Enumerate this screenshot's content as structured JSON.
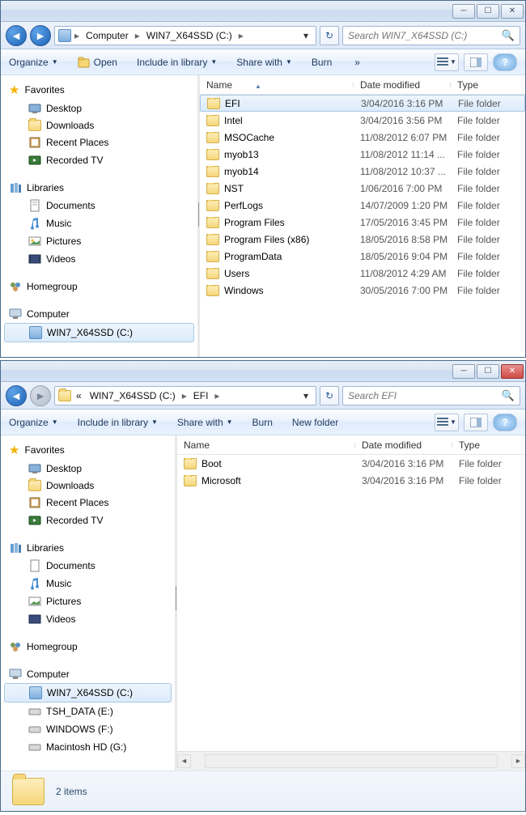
{
  "window1": {
    "breadcrumbs": [
      "Computer",
      "WIN7_X64SSD (C:)"
    ],
    "searchPlaceholder": "Search WIN7_X64SSD (C:)",
    "toolbar": {
      "organize": "Organize",
      "open": "Open",
      "include": "Include in library",
      "share": "Share with",
      "burn": "Burn",
      "more": "»"
    },
    "sidebar": {
      "favorites": {
        "label": "Favorites",
        "items": [
          "Desktop",
          "Downloads",
          "Recent Places",
          "Recorded TV"
        ]
      },
      "libraries": {
        "label": "Libraries",
        "items": [
          "Documents",
          "Music",
          "Pictures",
          "Videos"
        ]
      },
      "homegroup": {
        "label": "Homegroup"
      },
      "computer": {
        "label": "Computer",
        "items": [
          "WIN7_X64SSD (C:)"
        ]
      }
    },
    "columns": {
      "name": "Name",
      "date": "Date modified",
      "type": "Type"
    },
    "rows": [
      {
        "name": "EFI",
        "date": "3/04/2016 3:16 PM",
        "type": "File folder",
        "sel": true
      },
      {
        "name": "Intel",
        "date": "3/04/2016 3:56 PM",
        "type": "File folder"
      },
      {
        "name": "MSOCache",
        "date": "11/08/2012 6:07 PM",
        "type": "File folder"
      },
      {
        "name": "myob13",
        "date": "11/08/2012 11:14 ...",
        "type": "File folder"
      },
      {
        "name": "myob14",
        "date": "11/08/2012 10:37 ...",
        "type": "File folder"
      },
      {
        "name": "NST",
        "date": "1/06/2016 7:00 PM",
        "type": "File folder"
      },
      {
        "name": "PerfLogs",
        "date": "14/07/2009 1:20 PM",
        "type": "File folder"
      },
      {
        "name": "Program Files",
        "date": "17/05/2016 3:45 PM",
        "type": "File folder"
      },
      {
        "name": "Program Files (x86)",
        "date": "18/05/2016 8:58 PM",
        "type": "File folder"
      },
      {
        "name": "ProgramData",
        "date": "18/05/2016 9:04 PM",
        "type": "File folder"
      },
      {
        "name": "Users",
        "date": "11/08/2012 4:29 AM",
        "type": "File folder"
      },
      {
        "name": "Windows",
        "date": "30/05/2016 7:00 PM",
        "type": "File folder"
      }
    ]
  },
  "window2": {
    "breadcrumbs": [
      "«",
      "WIN7_X64SSD (C:)",
      "EFI"
    ],
    "searchPlaceholder": "Search EFI",
    "toolbar": {
      "organize": "Organize",
      "include": "Include in library",
      "share": "Share with",
      "burn": "Burn",
      "newfolder": "New folder"
    },
    "sidebar": {
      "favorites": {
        "label": "Favorites",
        "items": [
          "Desktop",
          "Downloads",
          "Recent Places",
          "Recorded TV"
        ]
      },
      "libraries": {
        "label": "Libraries",
        "items": [
          "Documents",
          "Music",
          "Pictures",
          "Videos"
        ]
      },
      "homegroup": {
        "label": "Homegroup"
      },
      "computer": {
        "label": "Computer",
        "items": [
          "WIN7_X64SSD (C:)",
          "TSH_DATA (E:)",
          "WINDOWS (F:)",
          "Macintosh HD (G:)"
        ]
      }
    },
    "columns": {
      "name": "Name",
      "date": "Date modified",
      "type": "Type"
    },
    "rows": [
      {
        "name": "Boot",
        "date": "3/04/2016 3:16 PM",
        "type": "File folder"
      },
      {
        "name": "Microsoft",
        "date": "3/04/2016 3:16 PM",
        "type": "File folder"
      }
    ],
    "status": "2 items"
  }
}
